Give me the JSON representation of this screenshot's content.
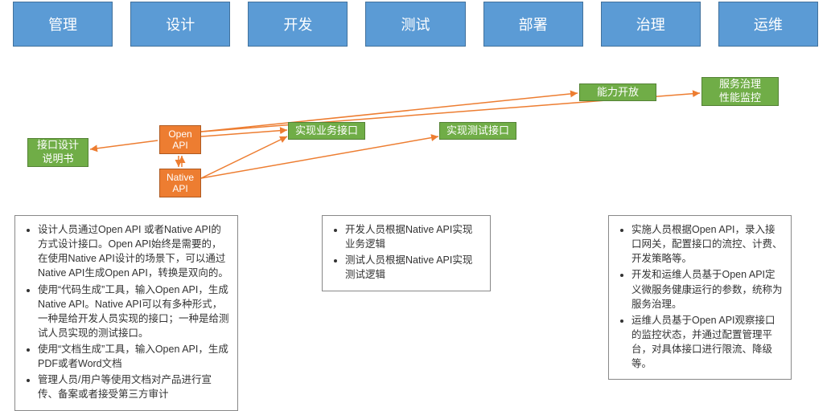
{
  "tabs": [
    "管理",
    "设计",
    "开发",
    "测试",
    "部署",
    "治理",
    "运维"
  ],
  "green": {
    "design_doc": "接口设计\n说明书",
    "biz_api": "实现业务接口",
    "test_api": "实现测试接口",
    "capability": "能力开放",
    "gov": "服务治理\n性能监控"
  },
  "orange": {
    "open": "Open\nAPI",
    "native": "Native\nAPI"
  },
  "panel_left": [
    "设计人员通过Open API 或者Native API的方式设计接口。Open API始终是需要的，在使用Native API设计的场景下，可以通过Native API生成Open API，转换是双向的。",
    "使用“代码生成”工具，输入Open API，生成Native API。Native API可以有多种形式，一种是给开发人员实现的接口；一种是给测试人员实现的测试接口。",
    "使用“文档生成”工具，输入Open API，生成PDF或者Word文档",
    "管理人员/用户等使用文档对产品进行宣传、备案或者接受第三方审计"
  ],
  "panel_mid": [
    "开发人员根据Native API实现业务逻辑",
    "测试人员根据Native API实现测试逻辑"
  ],
  "panel_right": [
    "实施人员根据Open API，录入接口网关，配置接口的流控、计费、开发策略等。",
    "开发和运维人员基于Open API定义微服务健康运行的参数，统称为服务治理。",
    "运维人员基于Open API观察接口的监控状态，并通过配置管理平台，对具体接口进行限流、降级等。"
  ]
}
